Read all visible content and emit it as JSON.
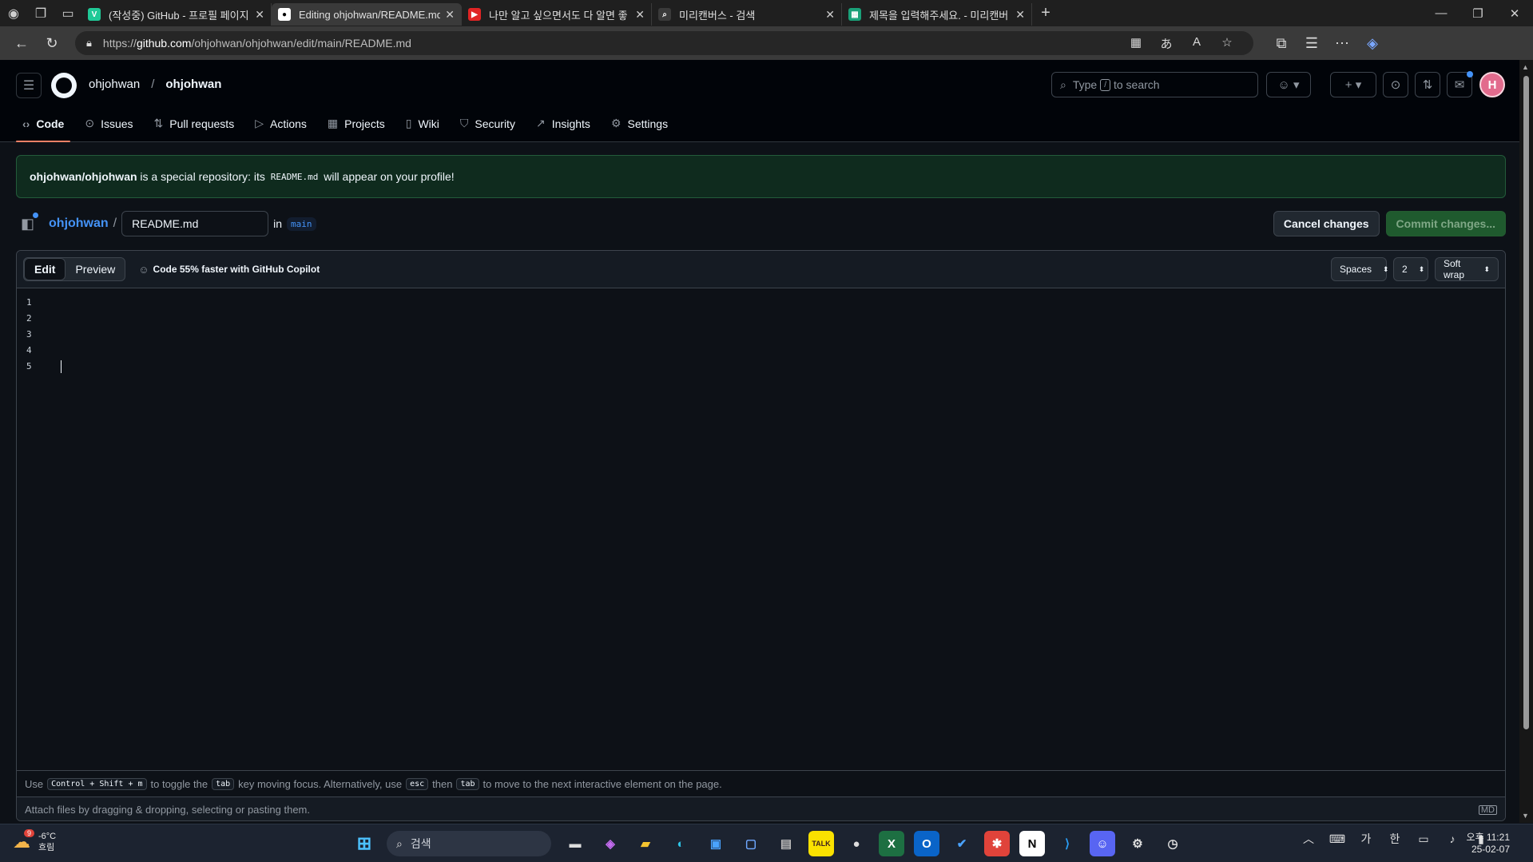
{
  "browser": {
    "tabs": [
      {
        "label": "(작성중) GitHub - 프로필 페이지",
        "fav": "V",
        "favbg": "#20c997",
        "active": false
      },
      {
        "label": "Editing ohjohwan/README.md at",
        "fav": "●",
        "favbg": "#ffffff",
        "active": true
      },
      {
        "label": "나만 알고 싶으면서도 다 알면 좋",
        "fav": "▶",
        "favbg": "#e02424",
        "active": false
      },
      {
        "label": "미리캔버스 - 검색",
        "fav": "⌕",
        "favbg": "#3a3a3a",
        "active": false
      },
      {
        "label": "제목을 입력해주세요. - 미리캔버",
        "fav": "▦",
        "favbg": "#1aa179",
        "active": false
      }
    ],
    "url_scheme": "https://",
    "url_host": "github.com",
    "url_path": "/ohjohwan/ohjohwan/edit/main/README.md"
  },
  "header": {
    "owner": "ohjohwan",
    "separator": "/",
    "repo": "ohjohwan",
    "search_prefix": "Type",
    "search_key": "/",
    "search_suffix": "to search",
    "avatar_letter": "H",
    "nav": [
      {
        "label": "Code",
        "icon": "‹›",
        "selected": true
      },
      {
        "label": "Issues",
        "icon": "⊙",
        "selected": false
      },
      {
        "label": "Pull requests",
        "icon": "⇅",
        "selected": false
      },
      {
        "label": "Actions",
        "icon": "▷",
        "selected": false
      },
      {
        "label": "Projects",
        "icon": "▦",
        "selected": false
      },
      {
        "label": "Wiki",
        "icon": "▯",
        "selected": false
      },
      {
        "label": "Security",
        "icon": "⛉",
        "selected": false
      },
      {
        "label": "Insights",
        "icon": "↗",
        "selected": false
      },
      {
        "label": "Settings",
        "icon": "⚙",
        "selected": false
      }
    ]
  },
  "flash": {
    "repo": "ohjohwan/ohjohwan",
    "text1": " is a special repository: its ",
    "file": "README.md",
    "text2": " will appear on your profile!"
  },
  "editor": {
    "path_owner": "ohjohwan",
    "path_sep": "/",
    "filename": "README.md",
    "in_label": "in",
    "branch": "main",
    "cancel_label": "Cancel changes",
    "commit_label": "Commit changes...",
    "tab_edit": "Edit",
    "tab_preview": "Preview",
    "copilot_text": "Code 55% faster with GitHub Copilot",
    "indent_mode": "Spaces",
    "indent_size": "2",
    "wrap_mode": "Soft wrap",
    "line_numbers": [
      "1",
      "2",
      "3",
      "4",
      "5"
    ],
    "hint": {
      "use": "Use",
      "key_toggle": "Control + Shift + m",
      "t1": "to toggle the",
      "key_tab": "tab",
      "t2": "key moving focus. Alternatively, use",
      "key_esc": "esc",
      "t3": "then",
      "key_tab2": "tab",
      "t4": "to move to the next interactive element on the page."
    },
    "attach_text": "Attach files by dragging & dropping, selecting or pasting them.",
    "md_badge": "MD"
  },
  "taskbar": {
    "temp": "-6°C",
    "weather": "흐림",
    "weather_badge": "9",
    "search_placeholder": "검색",
    "tray_lang1": "가",
    "tray_lang2": "한",
    "time": "오후 11:21",
    "date": "25-02-07"
  }
}
